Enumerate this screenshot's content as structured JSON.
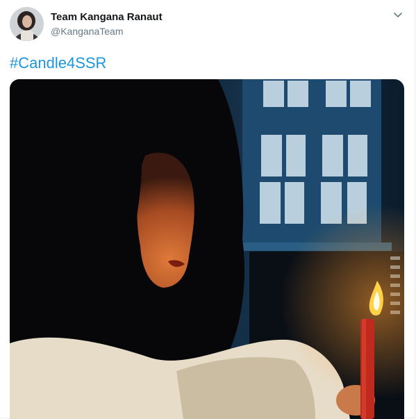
{
  "tweet": {
    "display_name": "Team Kangana Ranaut",
    "handle": "@KanganaTeam",
    "hashtag": "#Candle4SSR",
    "menu_icon": "chevron-down-icon",
    "avatar_icon": "profile-photo",
    "media_icon": "photo"
  },
  "colors": {
    "link": "#1b95e0",
    "name": "#14171a",
    "handle": "#657786"
  }
}
